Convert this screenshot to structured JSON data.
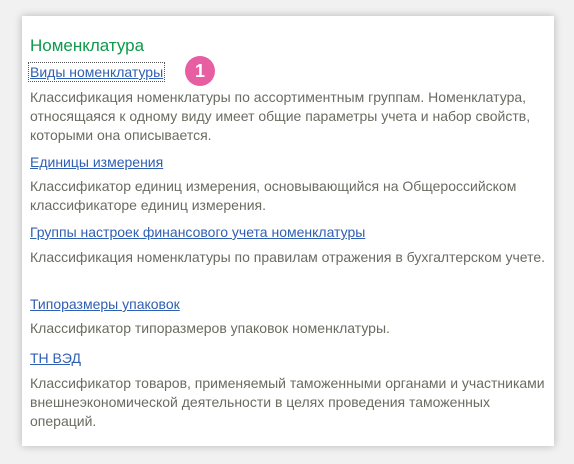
{
  "section": {
    "title": "Номенклатура"
  },
  "badge": "1",
  "items": [
    {
      "link": "Виды номенклатуры",
      "description": "Классификация номенклатуры по ассортиментным группам. Номенклатура, относящаяся к одному виду имеет общие параметры учета и набор свойств, которыми она описывается."
    },
    {
      "link": "Единицы измерения",
      "description": "Классификатор единиц измерения, основывающийся на Общероссийском классификаторе единиц измерения."
    },
    {
      "link": "Группы настроек финансового учета номенклатуры",
      "description": "Классификация номенклатуры по правилам отражения в бухгалтерском учете."
    },
    {
      "link": "Типоразмеры упаковок",
      "description": "Классификатор типоразмеров упаковок номенклатуры."
    },
    {
      "link": "ТН ВЭД",
      "description": "Классификатор товаров, применяемый таможенными органами и участниками внешнеэкономической деятельности в целях проведения таможенных операций."
    }
  ]
}
